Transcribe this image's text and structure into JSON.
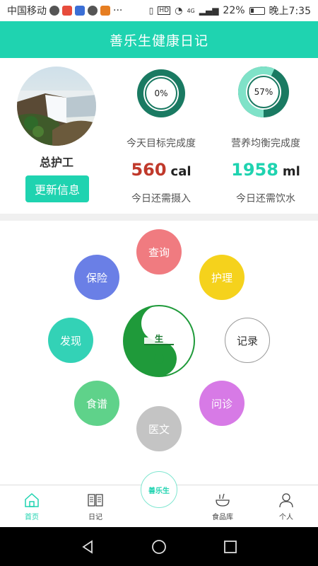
{
  "status_bar": {
    "carrier": "中国移动",
    "battery": "22%",
    "time": "晚上7:35",
    "signal_tag": "4G",
    "hd_tag": "HD"
  },
  "header": {
    "title": "善乐生健康日记"
  },
  "profile": {
    "name": "总护工",
    "update_button": "更新信息"
  },
  "stats": {
    "goal": {
      "percent": "0%",
      "value_fraction": 0.0,
      "label": "今天目标完成度",
      "amount": "560",
      "unit": "cal",
      "sub": "今日还需摄入",
      "color": "#c0392b"
    },
    "nutrition": {
      "percent": "57%",
      "value_fraction": 0.57,
      "label": "营养均衡完成度",
      "amount": "1958",
      "unit": "ml",
      "sub": "今日还需饮水",
      "color": "#1fd3b0"
    }
  },
  "menu": {
    "items": [
      {
        "id": "query",
        "label": "查询",
        "color": "#f07b80"
      },
      {
        "id": "insurance",
        "label": "保险",
        "color": "#6a7fe6"
      },
      {
        "id": "care",
        "label": "护理",
        "color": "#f5d21c"
      },
      {
        "id": "discover",
        "label": "发现",
        "color": "#33d2b6"
      },
      {
        "id": "record",
        "label": "记录",
        "color": "#ffffff"
      },
      {
        "id": "recipe",
        "label": "食谱",
        "color": "#5fd28a"
      },
      {
        "id": "consult",
        "label": "问诊",
        "color": "#d77ae6"
      },
      {
        "id": "medical",
        "label": "医文",
        "color": "#c4c4c4"
      }
    ],
    "center_char": "生"
  },
  "bottom_nav": {
    "home": "首页",
    "diary": "日记",
    "center_logo": "善乐生",
    "food": "食品库",
    "me": "个人"
  }
}
